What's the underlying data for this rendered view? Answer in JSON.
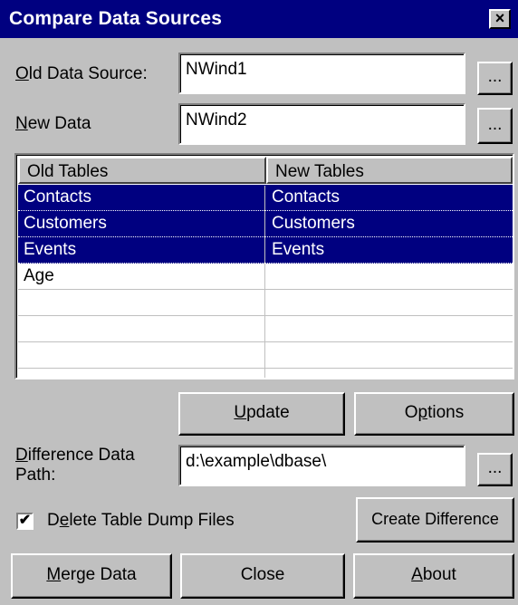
{
  "window": {
    "title": "Compare Data Sources",
    "close_glyph": "×"
  },
  "old_source": {
    "label_ul": "O",
    "label_rest": "ld Data Source:",
    "value": "NWind1",
    "browse": "..."
  },
  "new_source": {
    "label_ul": "N",
    "label_rest": "ew Data",
    "value": "NWind2",
    "browse": "..."
  },
  "table": {
    "columns": [
      "Old Tables",
      "New Tables"
    ],
    "rows": [
      {
        "old": "Contacts",
        "new": "Contacts",
        "selected": true
      },
      {
        "old": "Customers",
        "new": "Customers",
        "selected": true
      },
      {
        "old": "Events",
        "new": "Events",
        "selected": true
      },
      {
        "old": "Age",
        "new": "",
        "selected": false
      },
      {
        "old": "",
        "new": "",
        "selected": false
      },
      {
        "old": "",
        "new": "",
        "selected": false
      },
      {
        "old": "",
        "new": "",
        "selected": false
      }
    ]
  },
  "buttons": {
    "update_ul": "U",
    "update_rest": "pdate",
    "options_pre": "O",
    "options_ul": "p",
    "options_rest": "tions",
    "create_difference": "Create Difference",
    "merge_ul": "M",
    "merge_rest": "erge Data",
    "close": "Close",
    "about_ul": "A",
    "about_rest": "bout"
  },
  "diff_path": {
    "label_line1_ul": "D",
    "label_line1_rest": "ifference Data",
    "label_line2": "Path:",
    "value": "d:\\example\\dbase\\",
    "browse": "..."
  },
  "delete_dump": {
    "checked": true,
    "check_glyph": "✔",
    "label_pre": "D",
    "label_ul": "e",
    "label_rest": "lete Table Dump Files"
  }
}
